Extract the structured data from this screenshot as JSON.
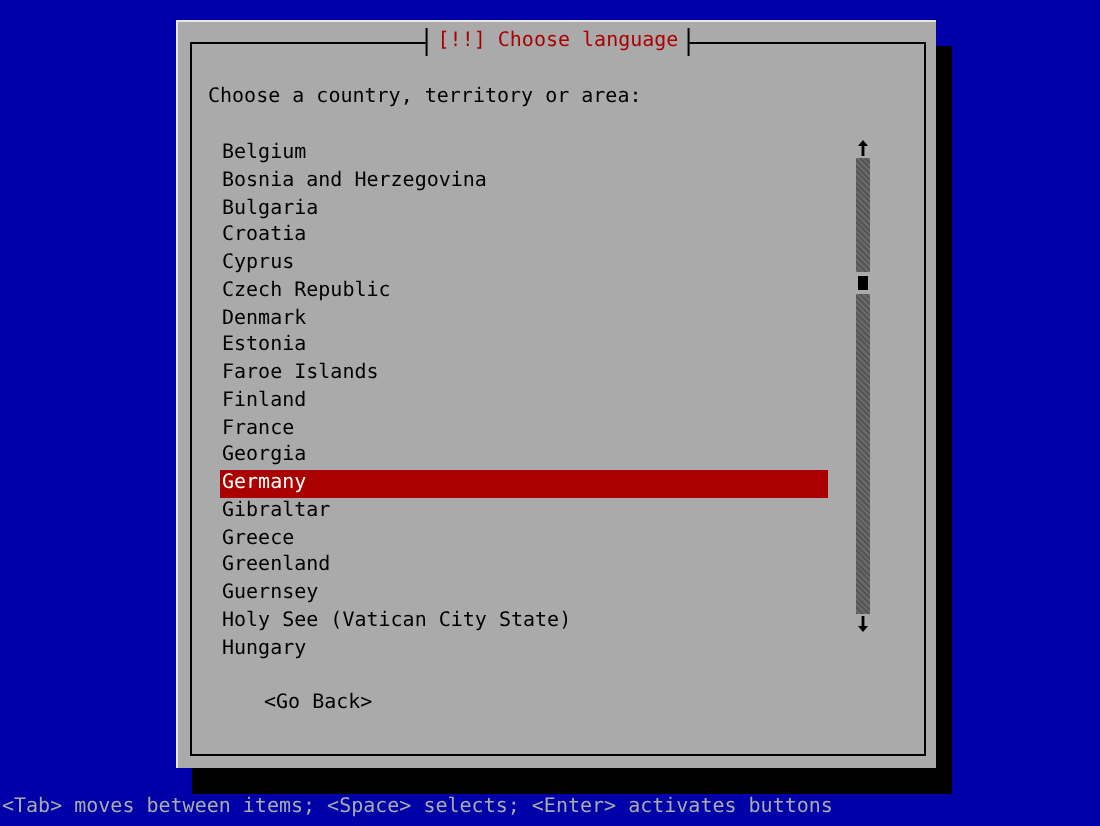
{
  "dialog": {
    "title": "[!!] Choose language",
    "prompt": "Choose a country, territory or area:",
    "items": [
      {
        "label": "Belgium",
        "selected": false
      },
      {
        "label": "Bosnia and Herzegovina",
        "selected": false
      },
      {
        "label": "Bulgaria",
        "selected": false
      },
      {
        "label": "Croatia",
        "selected": false
      },
      {
        "label": "Cyprus",
        "selected": false
      },
      {
        "label": "Czech Republic",
        "selected": false
      },
      {
        "label": "Denmark",
        "selected": false
      },
      {
        "label": "Estonia",
        "selected": false
      },
      {
        "label": "Faroe Islands",
        "selected": false
      },
      {
        "label": "Finland",
        "selected": false
      },
      {
        "label": "France",
        "selected": false
      },
      {
        "label": "Georgia",
        "selected": false
      },
      {
        "label": "Germany",
        "selected": true
      },
      {
        "label": "Gibraltar",
        "selected": false
      },
      {
        "label": "Greece",
        "selected": false
      },
      {
        "label": "Greenland",
        "selected": false
      },
      {
        "label": "Guernsey",
        "selected": false
      },
      {
        "label": "Holy See (Vatican City State)",
        "selected": false
      },
      {
        "label": "Hungary",
        "selected": false
      }
    ],
    "buttons": [
      "<Go Back>"
    ]
  },
  "help_line": "<Tab> moves between items; <Space> selects; <Enter> activates buttons"
}
